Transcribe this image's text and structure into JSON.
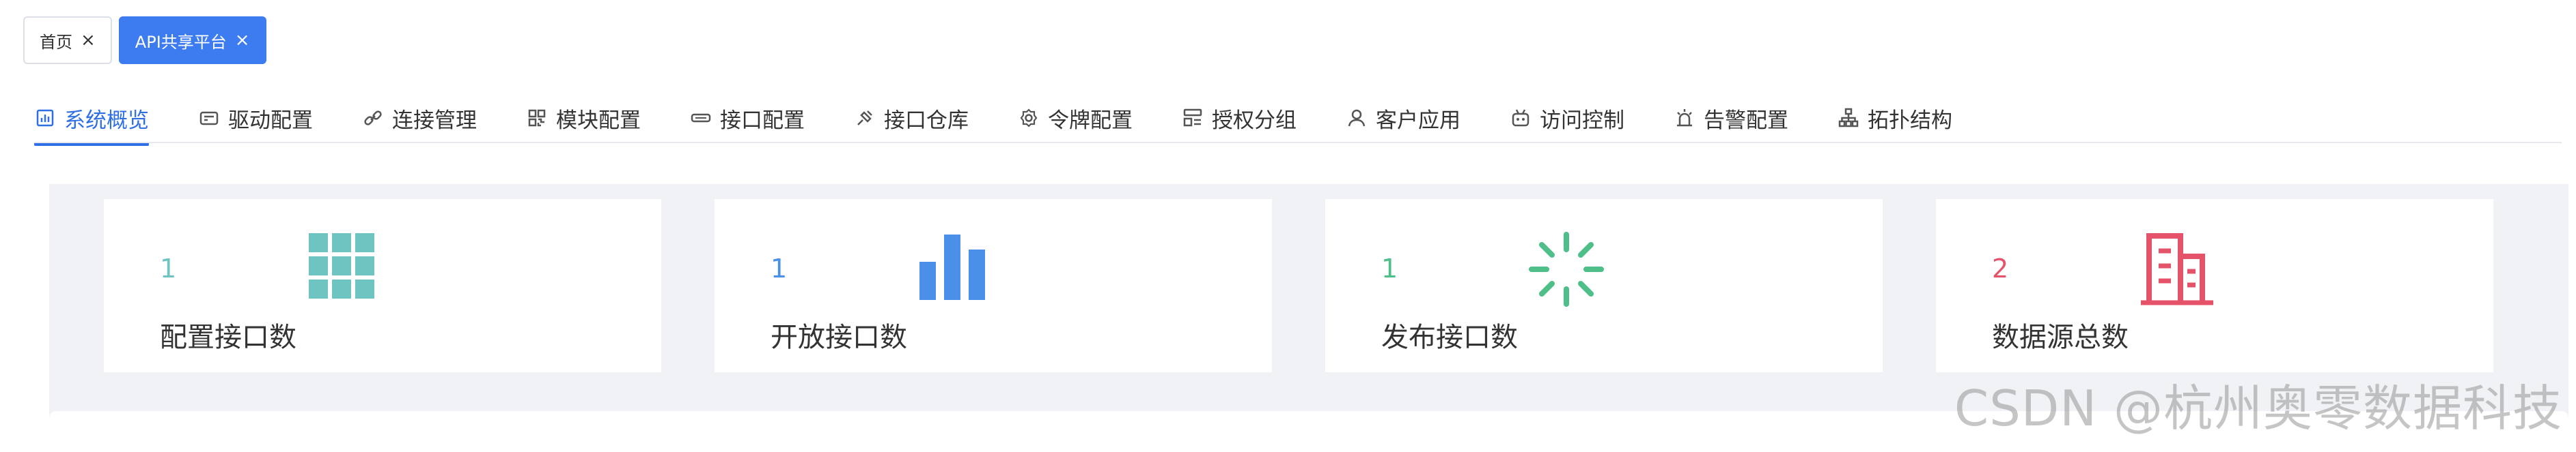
{
  "page_tabs": [
    {
      "label": "首页",
      "close": "×"
    },
    {
      "label": "API共享平台",
      "close": "×"
    }
  ],
  "module_tabs": [
    {
      "label": "系统概览",
      "icon": "dashboard-icon"
    },
    {
      "label": "驱动配置",
      "icon": "driver-icon"
    },
    {
      "label": "连接管理",
      "icon": "link-icon"
    },
    {
      "label": "模块配置",
      "icon": "module-icon"
    },
    {
      "label": "接口配置",
      "icon": "interface-icon"
    },
    {
      "label": "接口仓库",
      "icon": "repository-icon"
    },
    {
      "label": "令牌配置",
      "icon": "gear-icon"
    },
    {
      "label": "授权分组",
      "icon": "group-icon"
    },
    {
      "label": "客户应用",
      "icon": "user-icon"
    },
    {
      "label": "访问控制",
      "icon": "robot-icon"
    },
    {
      "label": "告警配置",
      "icon": "alarm-icon"
    },
    {
      "label": "拓扑结构",
      "icon": "topology-icon"
    }
  ],
  "stats": [
    {
      "value": "1",
      "label": "配置接口数",
      "icon": "grid-icon",
      "color": "#6ec4c0"
    },
    {
      "value": "1",
      "label": "开放接口数",
      "icon": "bar-chart-icon",
      "color": "#4a90e8"
    },
    {
      "value": "1",
      "label": "发布接口数",
      "icon": "loading-icon",
      "color": "#4fbf8a"
    },
    {
      "value": "2",
      "label": "数据源总数",
      "icon": "building-icon",
      "color": "#e4536a"
    }
  ],
  "colors": {
    "accent": "#2f6fe6",
    "active_tab_bg": "#3d7bf0",
    "panel_bg": "#f0f2f5"
  },
  "watermark": "CSDN @杭州奥零数据科技"
}
